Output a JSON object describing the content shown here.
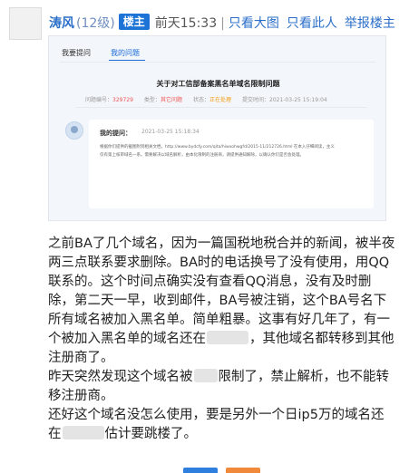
{
  "post": {
    "username": "涛风",
    "level": "(12级)",
    "owner_badge": "楼主",
    "post_time": "前天15:33",
    "separator": "|",
    "actions": [
      "只看大图",
      "只看此人",
      "举报"
    ],
    "floor_label": "楼主"
  },
  "screenshot": {
    "tabs": [
      "我要提问",
      "我的问题"
    ],
    "active_tab": "我的问题",
    "title": "关于对工信部备案黑名单域名限制问题",
    "meta": {
      "id_label": "问题编号：",
      "id_value": "329729",
      "type_label": "类型：",
      "type_value": "其它问题",
      "status_label": "状态：",
      "status_value": "正在处理",
      "submit_label": "提交时间：",
      "submit_value": "2021-03-25 15:19:04"
    },
    "question": {
      "label": "我的提问：",
      "time": "2021-03-25 15:18:34",
      "body": "根据你们提供的截图附到相关文档，http://www.bydcfy.com/qita/hiwxohwgfd/2015-11/212726.html 在本入仔细阅读，主义仅有第上核审域名一系。需要解决以域名解析，由本化限制的注册商，请提供通知解除，以确认你们是否会处理。"
    }
  },
  "content": {
    "paragraphs": [
      [
        "之前BA了几个域名，因为一篇国税地税合并的新闻，被半夜两三点联系要求删除。BA时的电话换号了没有使用，用QQ联系的。这个时间点确实没有查看QQ消息，没有及时删除，第二天一早，收到邮件，BA号被注销，这个BA号名下所有域名被加入黑名单。简单粗暴。这事有好几年了，有一个被加入黑名单的域名还在",
        "，其他域名都转移到其他注册商了。"
      ],
      [
        "昨天突然发现这个域名被",
        "限制了，禁止解析，也不能转移注册商。"
      ],
      [
        "还好这个域名没怎么使用，要是另外一个日ip5万的域名还在",
        "估计要跳楼了。"
      ]
    ]
  },
  "colors": {
    "link": "#2b6fc9",
    "owner_badge_bg": "#1e74d6",
    "tab_active": "#1a6ad6",
    "status_orange": "#f39c12",
    "id_red": "#e55",
    "button_blue": "#2f7fde",
    "button_orange": "#f08a3a"
  }
}
